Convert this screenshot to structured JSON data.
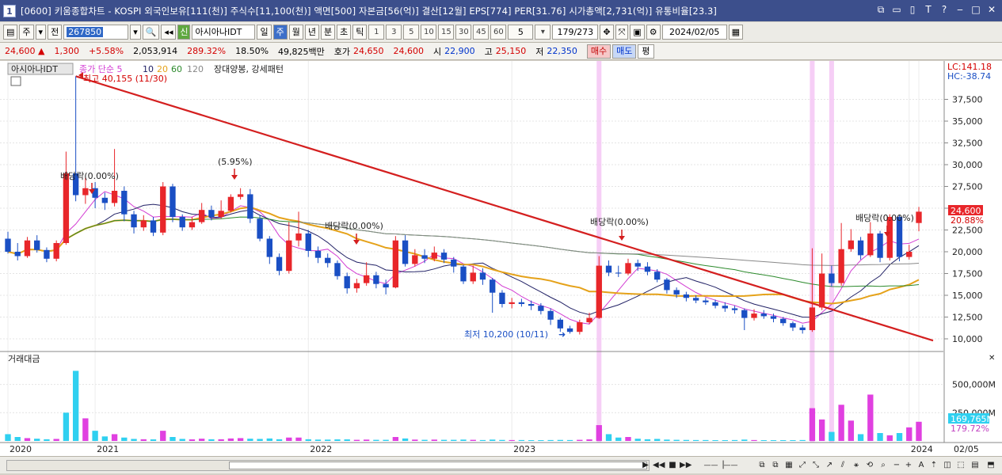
{
  "window": {
    "title": "[0600] 키움종합차트 - KOSPI 외국인보유[111(천)] 주식수[11,100(천)] 액면[500] 자본금[56(억)] 결산[12월] EPS[774] PER[31.76] 시가총액[2,731(억)] 유통비율[23.3]",
    "app_icon": "1",
    "controls": [
      "minimize-small",
      "restore",
      "pin",
      "text",
      "help",
      "minimize",
      "maximize",
      "close"
    ]
  },
  "toolbar": {
    "period_mode": "주",
    "prev_label": "전",
    "code": "267850",
    "stock_name": "아시아나IDT",
    "intervals": [
      "일",
      "주",
      "월",
      "년",
      "분",
      "초",
      "틱"
    ],
    "selected_interval": "주",
    "minute_options": [
      "1",
      "3",
      "5",
      "10",
      "15",
      "30",
      "45",
      "60"
    ],
    "minute_value": "5",
    "count": "179/273",
    "date": "2024/02/05",
    "credit_badge": "신"
  },
  "quote": {
    "price": "24,600",
    "change": "1,300",
    "change_pct": "+5.58%",
    "volume": "2,053,914",
    "volume_ratio": "289.32%",
    "turnover": "18.50%",
    "trade_value": "49,825백만",
    "ask_label": "호가",
    "ask": "24,650",
    "bid": "24,600",
    "open_label": "시",
    "open": "22,900",
    "high_label": "고",
    "high": "25,150",
    "low_label": "저",
    "low": "22,350",
    "buy_label": "매수",
    "sell_label": "매도",
    "eval_label": "평"
  },
  "chart": {
    "legend_name": "아시아나IDT",
    "legend_ma": "종가 단순 5",
    "legend_ma_periods": [
      "10",
      "20",
      "60",
      "120"
    ],
    "legend_pattern": "장대양봉, 강세패턴",
    "high_note": "최고 40,155 (11/30)",
    "low_note": "최저 10,200 (10/11)",
    "lc": "LC:141.18",
    "hc": "HC:-38.74",
    "y_ticks": [
      "37,500",
      "35,000",
      "32,500",
      "30,000",
      "27,500",
      "25,000",
      "22,500",
      "20,000",
      "17,500",
      "15,000",
      "12,500",
      "10,000"
    ],
    "current_price_tag": "24,600",
    "current_pct_tag": "20.88%",
    "annotations": [
      "배당락(0.00%)",
      "(5.95%)",
      "배당락(0.00%)",
      "배당락(0.00%)",
      "배당락(0.00%)"
    ],
    "volume_title": "거래대금",
    "vol_ticks": [
      "500,000M",
      "250,000M"
    ],
    "vol_current_tag": "169,765M",
    "vol_pct_tag": "179.72%",
    "x_labels": [
      "2020",
      "2021",
      "2022",
      "2023",
      "2024",
      "02/05"
    ],
    "colors": {
      "up": "#e8262a",
      "down": "#1a4fc4",
      "ma5": "#d33dd3",
      "ma10": "#222266",
      "ma20": "#e5a21a",
      "ma60": "#2c8a2c",
      "ma120": "#888888",
      "trend": "#d41f1f",
      "highlight": "#f4c6f4",
      "volume": "#2fd0f0"
    }
  },
  "chart_data": {
    "type": "candlestick",
    "x_range": [
      "2020",
      "2024/02/05"
    ],
    "ylim": [
      9500,
      40155
    ],
    "series": [
      {
        "name": "주가",
        "values": [
          [
            21500,
            20000,
            22300,
            19800
          ],
          [
            20000,
            19500,
            21000,
            19000
          ],
          [
            19500,
            21300,
            21700,
            19300
          ],
          [
            21300,
            20200,
            21900,
            19900
          ],
          [
            20200,
            19200,
            20500,
            18800
          ],
          [
            19200,
            21000,
            21300,
            18900
          ],
          [
            21000,
            29000,
            31500,
            20800
          ],
          [
            29000,
            26500,
            40155,
            25800
          ],
          [
            26500,
            27300,
            28500,
            25500
          ],
          [
            27300,
            26200,
            28000,
            25000
          ],
          [
            26200,
            25600,
            26800,
            24800
          ],
          [
            25600,
            27000,
            31800,
            25200
          ],
          [
            27000,
            24300,
            27500,
            23500
          ],
          [
            24300,
            22800,
            24700,
            22100
          ],
          [
            22800,
            23600,
            24200,
            22400
          ],
          [
            23600,
            22200,
            24000,
            21800
          ],
          [
            22200,
            27500,
            28000,
            21900
          ],
          [
            27500,
            24000,
            27800,
            23400
          ],
          [
            24000,
            22800,
            24300,
            22400
          ],
          [
            22800,
            23400,
            24000,
            22500
          ],
          [
            23400,
            24800,
            25600,
            23200
          ],
          [
            24800,
            24000,
            25300,
            23600
          ],
          [
            24000,
            24700,
            25900,
            23800
          ],
          [
            24700,
            26300,
            26600,
            24500
          ],
          [
            26300,
            26600,
            27300,
            26000
          ],
          [
            26600,
            23800,
            27200,
            23300
          ],
          [
            23800,
            21500,
            24200,
            21200
          ],
          [
            21500,
            19400,
            21800,
            18600
          ],
          [
            19400,
            17800,
            19800,
            17300
          ],
          [
            17800,
            21300,
            23400,
            17500
          ],
          [
            21300,
            22100,
            24600,
            20600
          ],
          [
            22100,
            20100,
            22500,
            19400
          ],
          [
            20100,
            19300,
            20600,
            18700
          ],
          [
            19300,
            18700,
            19800,
            18200
          ],
          [
            18700,
            17200,
            19000,
            16800
          ],
          [
            17200,
            15800,
            17600,
            15200
          ],
          [
            15800,
            16400,
            16900,
            15300
          ],
          [
            16400,
            17300,
            18800,
            16100
          ],
          [
            17300,
            16300,
            17700,
            15800
          ],
          [
            16300,
            15900,
            16800,
            15100
          ],
          [
            15900,
            21300,
            21800,
            15800
          ],
          [
            21300,
            18600,
            21900,
            18300
          ],
          [
            18600,
            19600,
            20300,
            18300
          ],
          [
            19600,
            19200,
            20300,
            18700
          ],
          [
            19200,
            19900,
            20600,
            18900
          ],
          [
            19900,
            19100,
            20300,
            18700
          ],
          [
            19100,
            18300,
            19400,
            17600
          ],
          [
            18300,
            16600,
            18500,
            16300
          ],
          [
            16600,
            17600,
            18400,
            16300
          ],
          [
            17600,
            16800,
            18100,
            16200
          ],
          [
            16800,
            15300,
            17000,
            13000
          ],
          [
            15300,
            14000,
            15600,
            13600
          ],
          [
            14000,
            14200,
            14700,
            13500
          ],
          [
            14200,
            14000,
            14600,
            13700
          ],
          [
            14000,
            13800,
            14400,
            13300
          ],
          [
            13800,
            13200,
            14100,
            12800
          ],
          [
            13200,
            12200,
            13500,
            11600
          ],
          [
            12200,
            11200,
            12400,
            10800
          ],
          [
            11200,
            10800,
            11500,
            10600
          ],
          [
            10800,
            11900,
            12200,
            10500
          ],
          [
            11900,
            12400,
            13000,
            11700
          ],
          [
            12400,
            18400,
            19500,
            12300
          ],
          [
            18400,
            17600,
            19000,
            17200
          ],
          [
            17600,
            17500,
            18400,
            17100
          ],
          [
            17500,
            18700,
            19200,
            17300
          ],
          [
            18700,
            18300,
            19100,
            17800
          ],
          [
            18300,
            17700,
            18800,
            17300
          ],
          [
            17700,
            16800,
            18000,
            16500
          ],
          [
            16800,
            15600,
            17000,
            15200
          ],
          [
            15600,
            15100,
            15900,
            14700
          ],
          [
            15100,
            14700,
            15400,
            14300
          ],
          [
            14700,
            14400,
            15000,
            14100
          ],
          [
            14400,
            14200,
            14700,
            13900
          ],
          [
            14200,
            13800,
            14500,
            13500
          ],
          [
            13800,
            13500,
            14200,
            13100
          ],
          [
            13500,
            13300,
            13800,
            12900
          ],
          [
            13300,
            12400,
            13500,
            11000
          ],
          [
            12400,
            12900,
            13400,
            12100
          ],
          [
            12900,
            12600,
            13300,
            12300
          ],
          [
            12600,
            12300,
            12900,
            11900
          ],
          [
            12300,
            11800,
            12500,
            11500
          ],
          [
            11800,
            11300,
            12000,
            10900
          ],
          [
            11300,
            11000,
            11600,
            10600
          ],
          [
            11000,
            13600,
            20400,
            10800
          ],
          [
            13600,
            17500,
            19800,
            13300
          ],
          [
            17500,
            16400,
            18400,
            16000
          ],
          [
            16400,
            20300,
            23300,
            16100
          ],
          [
            20300,
            21300,
            22600,
            20000
          ],
          [
            21300,
            19600,
            21700,
            19100
          ],
          [
            19600,
            22100,
            23400,
            19400
          ],
          [
            22100,
            19300,
            22400,
            18800
          ],
          [
            19300,
            24000,
            24300,
            19000
          ],
          [
            24000,
            19400,
            24200,
            18900
          ],
          [
            19400,
            20000,
            20800,
            19100
          ],
          [
            23300,
            24600,
            25150,
            22350
          ]
        ]
      }
    ],
    "legend": [
      "종가 단순 5",
      "10",
      "20",
      "60",
      "120"
    ],
    "trendline": {
      "from": [
        "2020/11/30",
        40155
      ],
      "to": [
        "2024/02/05",
        9800
      ]
    },
    "volume": {
      "name": "거래대금",
      "ylim": [
        0,
        700000
      ],
      "values": [
        60000,
        35000,
        25000,
        20000,
        15000,
        18000,
        250000,
        620000,
        200000,
        90000,
        40000,
        60000,
        30000,
        18000,
        15000,
        14000,
        90000,
        35000,
        18000,
        14000,
        20000,
        15000,
        15000,
        22000,
        25000,
        20000,
        18000,
        22000,
        15000,
        30000,
        30000,
        15000,
        12000,
        12000,
        14000,
        14000,
        10000,
        12000,
        10000,
        10000,
        35000,
        22000,
        12000,
        10000,
        12000,
        10000,
        10000,
        12000,
        10000,
        8000,
        12000,
        9000,
        8000,
        8000,
        7000,
        7000,
        8000,
        9000,
        8000,
        10000,
        14000,
        140000,
        60000,
        30000,
        35000,
        20000,
        15000,
        18000,
        12000,
        10000,
        9000,
        8000,
        8000,
        7000,
        7000,
        8000,
        12000,
        8000,
        7000,
        7000,
        7000,
        7000,
        8000,
        290000,
        190000,
        80000,
        320000,
        180000,
        60000,
        410000,
        70000,
        50000,
        70000,
        120000,
        169765
      ]
    }
  }
}
